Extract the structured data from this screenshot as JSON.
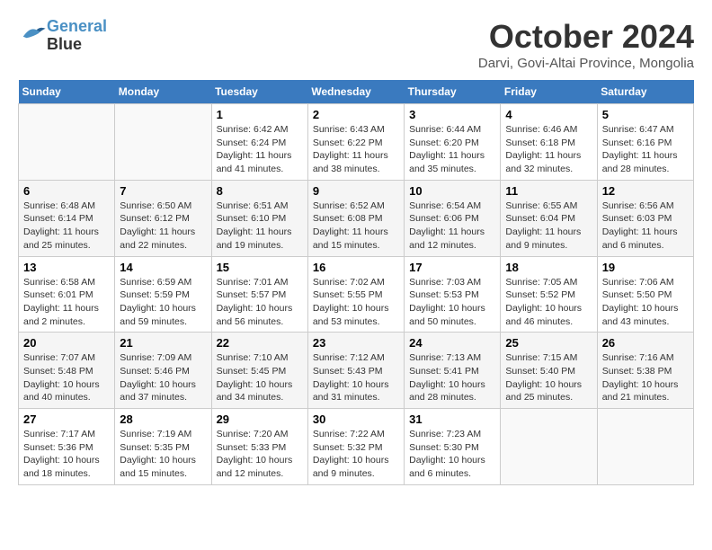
{
  "header": {
    "logo_line1": "General",
    "logo_line2": "Blue",
    "title": "October 2024",
    "location": "Darvi, Govi-Altai Province, Mongolia"
  },
  "days_of_week": [
    "Sunday",
    "Monday",
    "Tuesday",
    "Wednesday",
    "Thursday",
    "Friday",
    "Saturday"
  ],
  "weeks": [
    [
      {
        "day": "",
        "info": ""
      },
      {
        "day": "",
        "info": ""
      },
      {
        "day": "1",
        "info": "Sunrise: 6:42 AM\nSunset: 6:24 PM\nDaylight: 11 hours and 41 minutes."
      },
      {
        "day": "2",
        "info": "Sunrise: 6:43 AM\nSunset: 6:22 PM\nDaylight: 11 hours and 38 minutes."
      },
      {
        "day": "3",
        "info": "Sunrise: 6:44 AM\nSunset: 6:20 PM\nDaylight: 11 hours and 35 minutes."
      },
      {
        "day": "4",
        "info": "Sunrise: 6:46 AM\nSunset: 6:18 PM\nDaylight: 11 hours and 32 minutes."
      },
      {
        "day": "5",
        "info": "Sunrise: 6:47 AM\nSunset: 6:16 PM\nDaylight: 11 hours and 28 minutes."
      }
    ],
    [
      {
        "day": "6",
        "info": "Sunrise: 6:48 AM\nSunset: 6:14 PM\nDaylight: 11 hours and 25 minutes."
      },
      {
        "day": "7",
        "info": "Sunrise: 6:50 AM\nSunset: 6:12 PM\nDaylight: 11 hours and 22 minutes."
      },
      {
        "day": "8",
        "info": "Sunrise: 6:51 AM\nSunset: 6:10 PM\nDaylight: 11 hours and 19 minutes."
      },
      {
        "day": "9",
        "info": "Sunrise: 6:52 AM\nSunset: 6:08 PM\nDaylight: 11 hours and 15 minutes."
      },
      {
        "day": "10",
        "info": "Sunrise: 6:54 AM\nSunset: 6:06 PM\nDaylight: 11 hours and 12 minutes."
      },
      {
        "day": "11",
        "info": "Sunrise: 6:55 AM\nSunset: 6:04 PM\nDaylight: 11 hours and 9 minutes."
      },
      {
        "day": "12",
        "info": "Sunrise: 6:56 AM\nSunset: 6:03 PM\nDaylight: 11 hours and 6 minutes."
      }
    ],
    [
      {
        "day": "13",
        "info": "Sunrise: 6:58 AM\nSunset: 6:01 PM\nDaylight: 11 hours and 2 minutes."
      },
      {
        "day": "14",
        "info": "Sunrise: 6:59 AM\nSunset: 5:59 PM\nDaylight: 10 hours and 59 minutes."
      },
      {
        "day": "15",
        "info": "Sunrise: 7:01 AM\nSunset: 5:57 PM\nDaylight: 10 hours and 56 minutes."
      },
      {
        "day": "16",
        "info": "Sunrise: 7:02 AM\nSunset: 5:55 PM\nDaylight: 10 hours and 53 minutes."
      },
      {
        "day": "17",
        "info": "Sunrise: 7:03 AM\nSunset: 5:53 PM\nDaylight: 10 hours and 50 minutes."
      },
      {
        "day": "18",
        "info": "Sunrise: 7:05 AM\nSunset: 5:52 PM\nDaylight: 10 hours and 46 minutes."
      },
      {
        "day": "19",
        "info": "Sunrise: 7:06 AM\nSunset: 5:50 PM\nDaylight: 10 hours and 43 minutes."
      }
    ],
    [
      {
        "day": "20",
        "info": "Sunrise: 7:07 AM\nSunset: 5:48 PM\nDaylight: 10 hours and 40 minutes."
      },
      {
        "day": "21",
        "info": "Sunrise: 7:09 AM\nSunset: 5:46 PM\nDaylight: 10 hours and 37 minutes."
      },
      {
        "day": "22",
        "info": "Sunrise: 7:10 AM\nSunset: 5:45 PM\nDaylight: 10 hours and 34 minutes."
      },
      {
        "day": "23",
        "info": "Sunrise: 7:12 AM\nSunset: 5:43 PM\nDaylight: 10 hours and 31 minutes."
      },
      {
        "day": "24",
        "info": "Sunrise: 7:13 AM\nSunset: 5:41 PM\nDaylight: 10 hours and 28 minutes."
      },
      {
        "day": "25",
        "info": "Sunrise: 7:15 AM\nSunset: 5:40 PM\nDaylight: 10 hours and 25 minutes."
      },
      {
        "day": "26",
        "info": "Sunrise: 7:16 AM\nSunset: 5:38 PM\nDaylight: 10 hours and 21 minutes."
      }
    ],
    [
      {
        "day": "27",
        "info": "Sunrise: 7:17 AM\nSunset: 5:36 PM\nDaylight: 10 hours and 18 minutes."
      },
      {
        "day": "28",
        "info": "Sunrise: 7:19 AM\nSunset: 5:35 PM\nDaylight: 10 hours and 15 minutes."
      },
      {
        "day": "29",
        "info": "Sunrise: 7:20 AM\nSunset: 5:33 PM\nDaylight: 10 hours and 12 minutes."
      },
      {
        "day": "30",
        "info": "Sunrise: 7:22 AM\nSunset: 5:32 PM\nDaylight: 10 hours and 9 minutes."
      },
      {
        "day": "31",
        "info": "Sunrise: 7:23 AM\nSunset: 5:30 PM\nDaylight: 10 hours and 6 minutes."
      },
      {
        "day": "",
        "info": ""
      },
      {
        "day": "",
        "info": ""
      }
    ]
  ]
}
